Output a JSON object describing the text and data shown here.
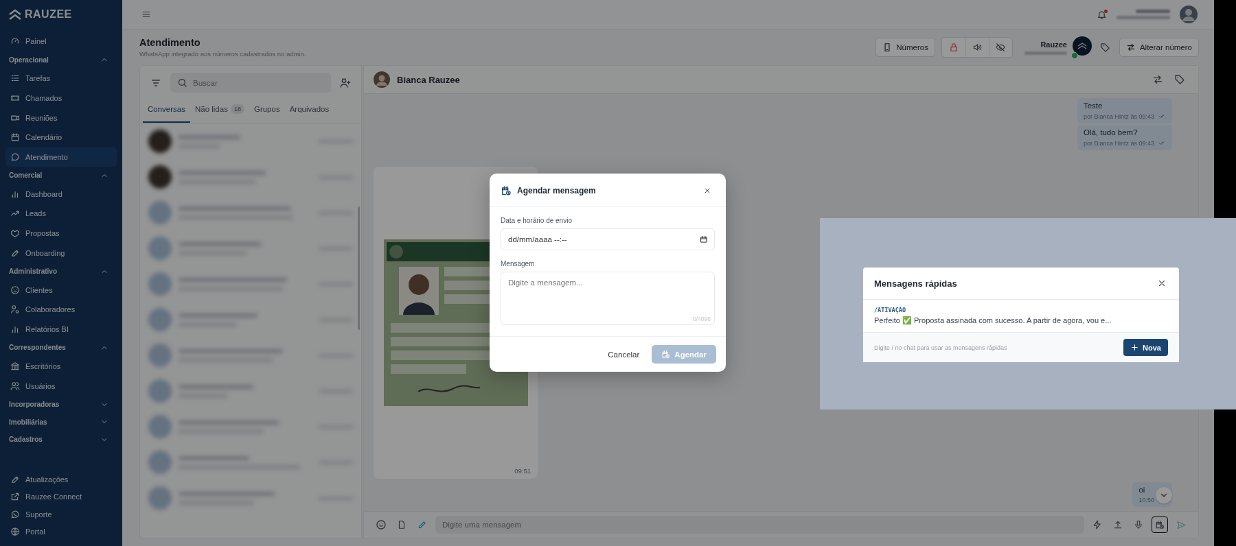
{
  "sidebar": {
    "logo": "RAUZEE",
    "items": [
      {
        "kind": "link",
        "label": "Painel",
        "selected": false
      },
      {
        "kind": "section",
        "label": "Operacional",
        "expanded": true
      },
      {
        "kind": "link",
        "label": "Tarefas",
        "selected": false
      },
      {
        "kind": "link",
        "label": "Chamados",
        "selected": false
      },
      {
        "kind": "link",
        "label": "Reuniões",
        "selected": false
      },
      {
        "kind": "link",
        "label": "Calendário",
        "selected": false
      },
      {
        "kind": "link",
        "label": "Atendimento",
        "selected": true
      },
      {
        "kind": "section",
        "label": "Comercial",
        "expanded": true
      },
      {
        "kind": "link",
        "label": "Dashboard",
        "selected": false
      },
      {
        "kind": "link",
        "label": "Leads",
        "selected": false
      },
      {
        "kind": "link",
        "label": "Propostas",
        "selected": false
      },
      {
        "kind": "link",
        "label": "Onboarding",
        "selected": false
      },
      {
        "kind": "section",
        "label": "Administrativo",
        "expanded": true
      },
      {
        "kind": "link",
        "label": "Clientes",
        "selected": false
      },
      {
        "kind": "link",
        "label": "Colaboradores",
        "selected": false
      },
      {
        "kind": "link",
        "label": "Relatórios BI",
        "selected": false
      },
      {
        "kind": "section",
        "label": "Correspondentes",
        "expanded": true
      },
      {
        "kind": "link",
        "label": "Escritórios",
        "selected": false
      },
      {
        "kind": "link",
        "label": "Usuários",
        "selected": false
      },
      {
        "kind": "section",
        "label": "Incorporadoras",
        "expanded": false
      },
      {
        "kind": "section",
        "label": "Imobiliárias",
        "expanded": false
      },
      {
        "kind": "section",
        "label": "Cadastros",
        "expanded": false
      }
    ],
    "footer": [
      {
        "label": "Atualizações"
      },
      {
        "label": "Rauzee Connect"
      },
      {
        "label": "Suporte"
      },
      {
        "label": "Portal"
      }
    ]
  },
  "topbar": {
    "unread_notifications": true
  },
  "header": {
    "title": "Atendimento",
    "subtitle": "WhatsApp integrado aos números cadastrados no admin.",
    "numbers_button": "Números",
    "account_name": "Rauzee",
    "account_online": true,
    "change_button": "Alterar número"
  },
  "conversations": {
    "search_placeholder": "Buscar",
    "tabs": [
      {
        "label": "Conversas",
        "selected": true
      },
      {
        "label": "Não lidas",
        "badge": "18",
        "selected": false
      },
      {
        "label": "Grupos",
        "selected": false
      },
      {
        "label": "Arquivados",
        "selected": false
      }
    ]
  },
  "chat": {
    "contact": "Bianca Rauzee",
    "messages": [
      {
        "kind": "text",
        "outgoing": true,
        "text": "Teste",
        "meta": "por Bianca Hintz às 09:43"
      },
      {
        "kind": "text",
        "outgoing": true,
        "text": "Olá, tudo bem?",
        "meta": "por Bianca Hintz às 09:43"
      },
      {
        "kind": "picture",
        "outgoing": false,
        "time": "09:51"
      },
      {
        "kind": "text",
        "outgoing": true,
        "text": "oi",
        "time": "10:50"
      }
    ],
    "composer_placeholder": "Digite uma mensagem",
    "schedule_active": true
  },
  "schedule_dialog": {
    "title": "Agendar mensagem",
    "date_label": "Data e horário de envio",
    "date_placeholder": "dd/mm/aaaa --:--",
    "message_label": "Mensagem",
    "message_placeholder": "Digite a mensagem...",
    "counter": "0/4096",
    "cancel": "Cancelar",
    "submit": "Agendar",
    "submit_disabled": true
  },
  "quick_messages": {
    "title": "Mensagens rápidas",
    "items": [
      {
        "shortcut": "/ATIVAÇÃO",
        "text": "Perfeito ✅ Proposta assinada com sucesso. A partir de agora, vou e..."
      }
    ],
    "hint": "Digite / no chat para usar as mensagens rápidas",
    "new_button": "Nova"
  }
}
